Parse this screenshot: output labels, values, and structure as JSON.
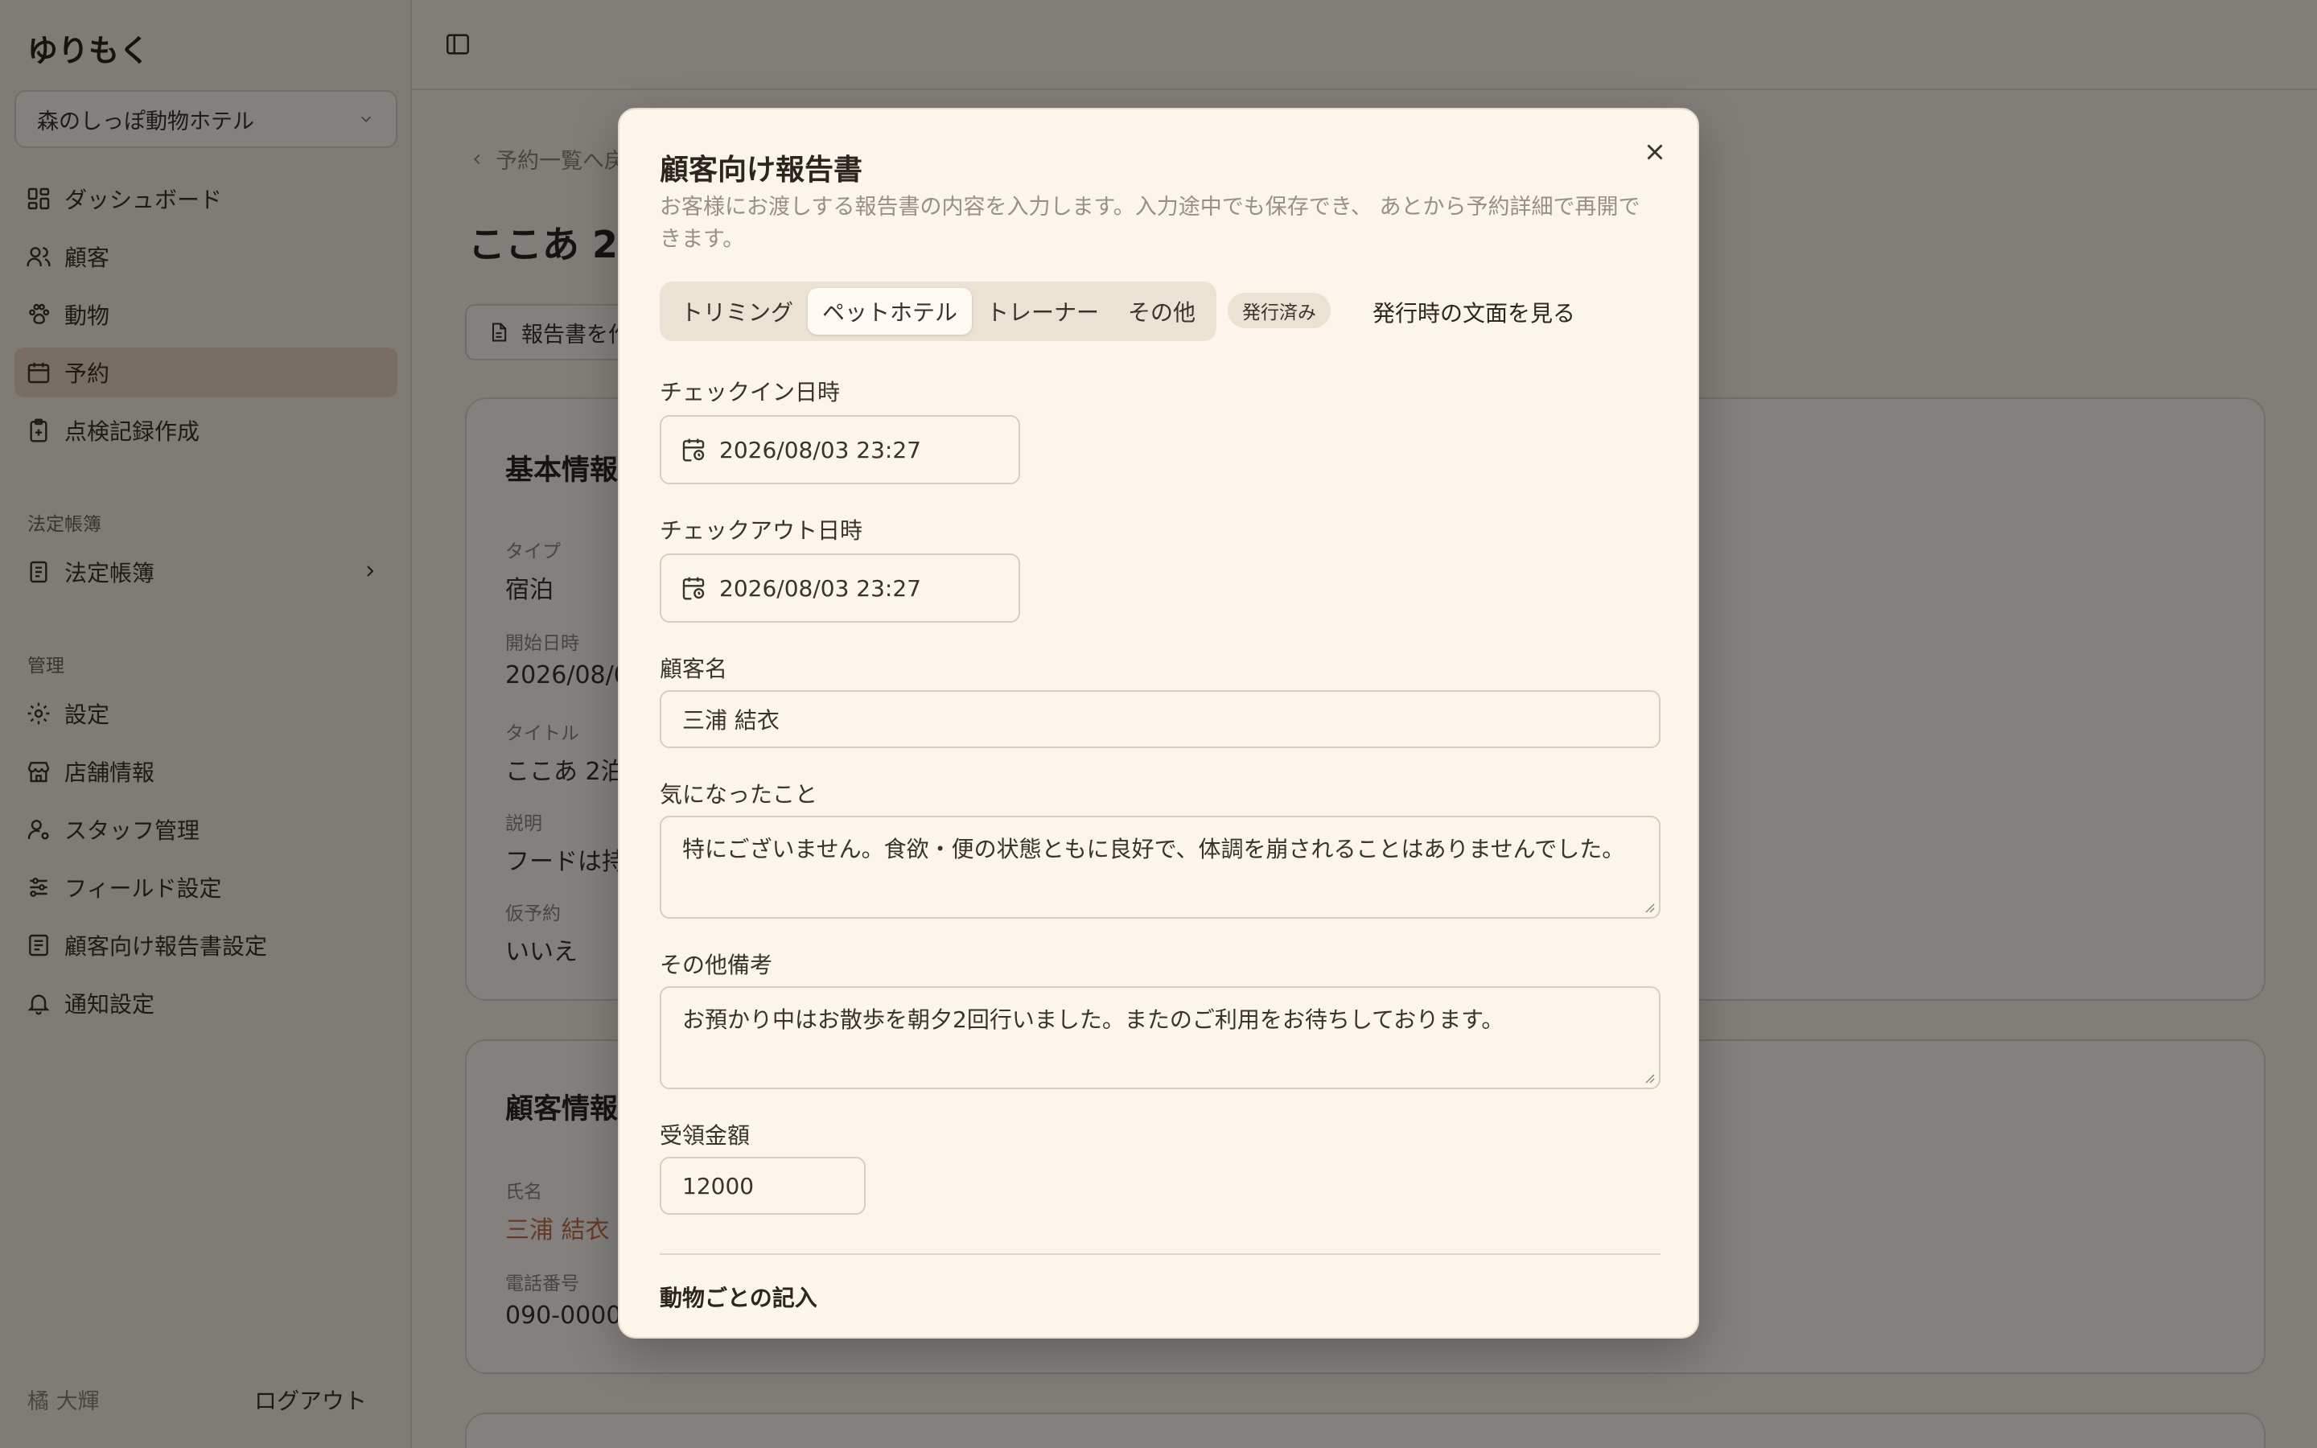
{
  "app": {
    "name": "ゆりもく"
  },
  "store_selector": {
    "value": "森のしっぽ動物ホテル"
  },
  "sidebar": {
    "nav": [
      {
        "label": "ダッシュボード",
        "icon": "dashboard-icon"
      },
      {
        "label": "顧客",
        "icon": "users-icon"
      },
      {
        "label": "動物",
        "icon": "paw-icon"
      },
      {
        "label": "予約",
        "icon": "calendar-icon",
        "active": true
      },
      {
        "label": "点検記録作成",
        "icon": "clipboard-icon"
      }
    ],
    "legal_section": "法定帳簿",
    "legal_item": {
      "label": "法定帳簿",
      "icon": "ledger-icon"
    },
    "admin_section": "管理",
    "admin_items": [
      {
        "label": "設定",
        "icon": "gear-icon"
      },
      {
        "label": "店舗情報",
        "icon": "store-icon"
      },
      {
        "label": "スタッフ管理",
        "icon": "user-cog-icon"
      },
      {
        "label": "フィールド設定",
        "icon": "sliders-icon"
      },
      {
        "label": "顧客向け報告書設定",
        "icon": "report-settings-icon"
      },
      {
        "label": "通知設定",
        "icon": "bell-icon"
      }
    ],
    "user_name": "橘 大輝",
    "logout_label": "ログアウト"
  },
  "main": {
    "breadcrumb": "予約一覧へ戻る",
    "title": "ここあ 2泊",
    "report_button": "報告書を作成",
    "basic_card": {
      "title": "基本情報",
      "fields": [
        {
          "label": "タイプ",
          "value": "宿泊"
        },
        {
          "label": "開始日時",
          "value": "2026/08/03 23:27"
        },
        {
          "label": "タイトル",
          "value": "ここあ 2泊"
        },
        {
          "label": "説明",
          "value": "フードは持参"
        },
        {
          "label": "仮予約",
          "value": "いいえ"
        }
      ]
    },
    "customer_card": {
      "title": "顧客情報",
      "fields": [
        {
          "label": "氏名",
          "value": "三浦 結衣"
        },
        {
          "label": "電話番号",
          "value": "090-0000-0000"
        }
      ]
    }
  },
  "dialog": {
    "title": "顧客向け報告書",
    "description": "お客様にお渡しする報告書の内容を入力します。入力途中でも保存でき、 あとから予約詳細で再開できます。",
    "tabs": [
      {
        "label": "トリミング",
        "active": false
      },
      {
        "label": "ペットホテル",
        "active": true
      },
      {
        "label": "トレーナー",
        "active": false
      },
      {
        "label": "その他",
        "active": false
      }
    ],
    "status_badge": "発行済み",
    "view_issued_link": "発行時の文面を見る",
    "checkin": {
      "label": "チェックイン日時",
      "value": "2026/08/03 23:27"
    },
    "checkout": {
      "label": "チェックアウト日時",
      "value": "2026/08/03 23:27"
    },
    "customer_name": {
      "label": "顧客名",
      "value": "三浦 結衣"
    },
    "concerns": {
      "label": "気になったこと",
      "value": "特にございません。食欲・便の状態ともに良好で、体調を崩されることはありませんでした。"
    },
    "remarks": {
      "label": "その他備考",
      "value": "お預かり中はお散歩を朝夕2回行いました。またのご利用をお待ちしております。"
    },
    "amount": {
      "label": "受領金額",
      "value": "12000"
    },
    "per_animal_heading": "動物ごとの記入"
  }
}
